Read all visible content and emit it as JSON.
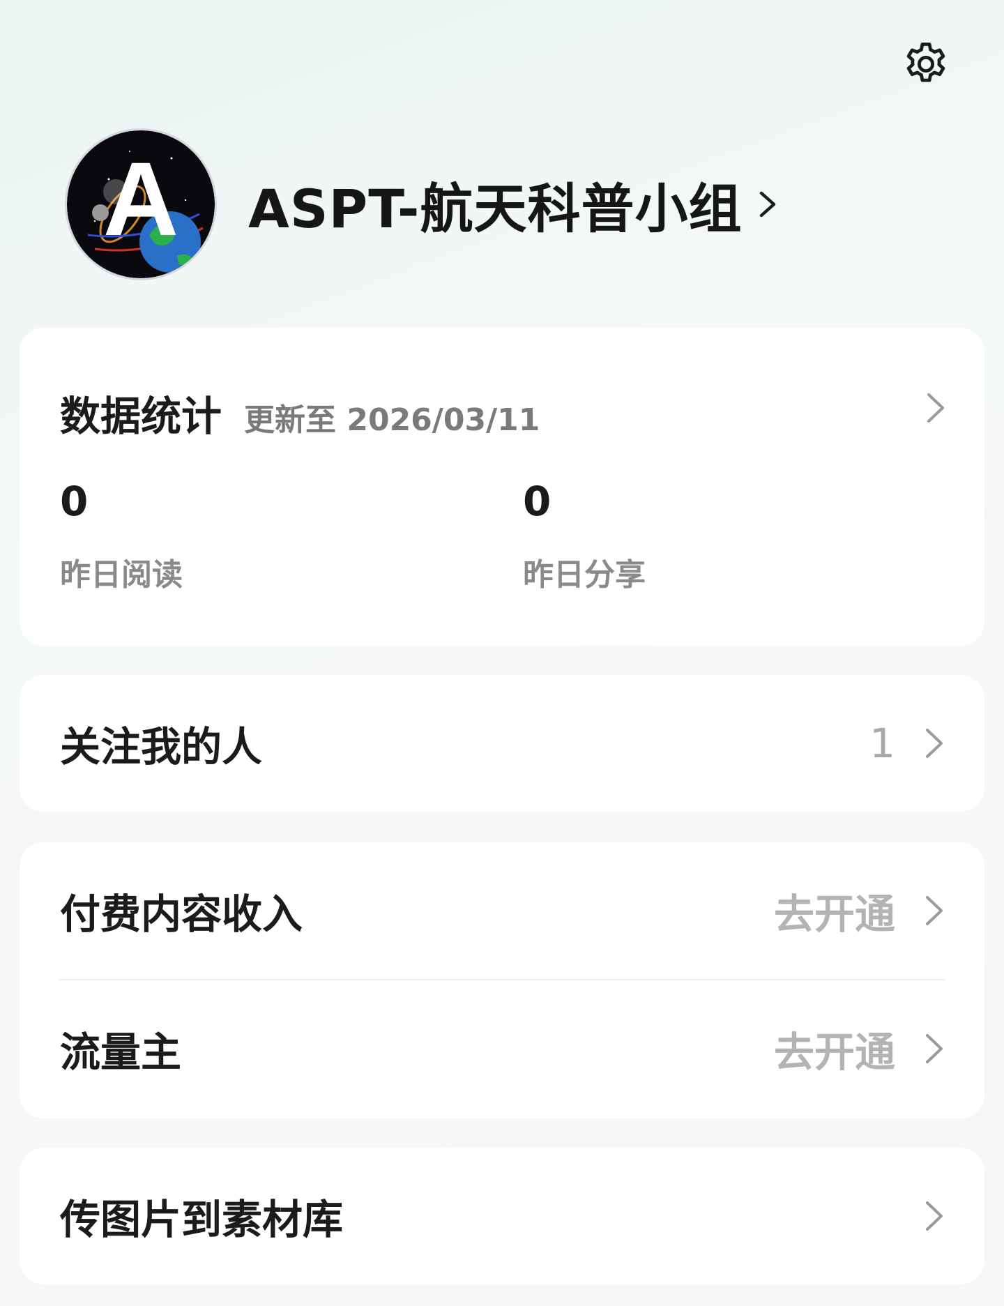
{
  "header": {
    "settings_icon": "gear-icon",
    "account_name": "ASPT-航天科普小组",
    "avatar_logo_text": "A"
  },
  "stats": {
    "title": "数据统计",
    "updated": "更新至 2026/03/11",
    "metrics": [
      {
        "value": "0",
        "label": "昨日阅读"
      },
      {
        "value": "0",
        "label": "昨日分享"
      }
    ]
  },
  "followers": {
    "label": "关注我的人",
    "count": "1"
  },
  "monetization": {
    "paid_content": {
      "label": "付费内容收入",
      "action": "去开通"
    },
    "traffic_host": {
      "label": "流量主",
      "action": "去开通"
    }
  },
  "materials": {
    "label": "传图片到素材库"
  },
  "colors": {
    "card": "#ffffff",
    "title_text": "#1b1b1b",
    "muted_text": "#8a8a8a",
    "action_text": "#b3b3b3",
    "background_tint": "#eaf4f2"
  }
}
